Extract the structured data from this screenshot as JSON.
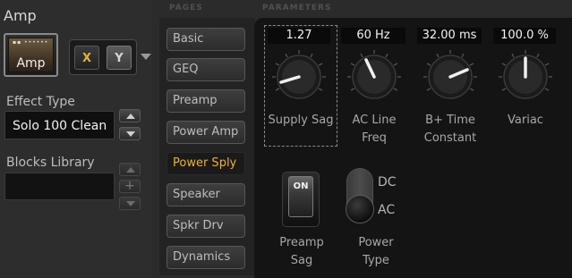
{
  "block": {
    "title": "Amp",
    "thumbnail_label": "Amp",
    "x_label": "X",
    "y_label": "Y"
  },
  "effect_type": {
    "label": "Effect Type",
    "value": "Solo 100 Clean"
  },
  "blocks_library": {
    "label": "Blocks Library",
    "add_symbol": "+"
  },
  "headers": {
    "pages": "PAGES",
    "parameters": "PARAMETERS"
  },
  "pages": [
    {
      "label": "Basic"
    },
    {
      "label": "GEQ"
    },
    {
      "label": "Preamp"
    },
    {
      "label": "Power Amp"
    },
    {
      "label": "Power Sply"
    },
    {
      "label": "Speaker"
    },
    {
      "label": "Spkr Drv"
    },
    {
      "label": "Dynamics"
    }
  ],
  "active_page": "Power Sply",
  "knobs": [
    {
      "name": "supply-sag",
      "value": "1.27",
      "label_line1": "Supply Sag",
      "label_line2": ""
    },
    {
      "name": "ac-line-freq",
      "value": "60 Hz",
      "label_line1": "AC Line",
      "label_line2": "Freq"
    },
    {
      "name": "b-plus-time-constant",
      "value": "32.00 ms",
      "label_line1": "B+ Time",
      "label_line2": "Constant"
    },
    {
      "name": "variac",
      "value": "100.0 %",
      "label_line1": "Variac",
      "label_line2": ""
    }
  ],
  "preamp_sag": {
    "switch_label": "ON",
    "label_line1": "Preamp",
    "label_line2": "Sag"
  },
  "power_type": {
    "option_top": "DC",
    "option_bottom": "AC",
    "selected": "AC",
    "label_line1": "Power",
    "label_line2": "Type"
  },
  "colors": {
    "accent": "#f0b030",
    "panel": "#141414",
    "background": "#2b2b2b"
  }
}
